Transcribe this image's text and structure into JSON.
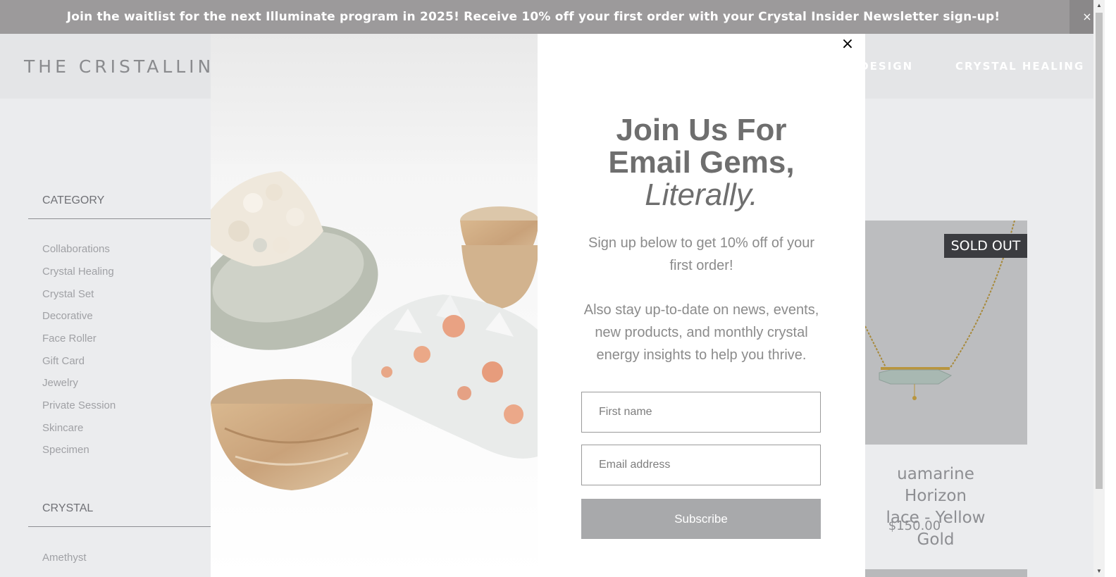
{
  "announcement": {
    "text": "Join the waitlist for the next Illuminate program in 2025! Receive 10% off your first order with your Crystal Insider Newsletter sign-up!",
    "close_label": "×"
  },
  "header": {
    "logo": "THE CRISTALLINE",
    "nav": [
      "C DESIGN",
      "CRYSTAL HEALING"
    ]
  },
  "sidebar": {
    "category_heading": "CATEGORY",
    "categories": [
      "Collaborations",
      "Crystal Healing",
      "Crystal Set",
      "Decorative",
      "Face Roller",
      "Gift Card",
      "Jewelry",
      "Private Session",
      "Skincare",
      "Specimen"
    ],
    "crystal_heading": "CRYSTAL",
    "crystals": [
      "Amethyst"
    ]
  },
  "product": {
    "badge": "SOLD OUT",
    "name_line1": "uamarine Horizon",
    "name_line2": "lace - Yellow Gold",
    "price": "$150.00"
  },
  "modal": {
    "close_label": "×",
    "headline_line1": "Join Us For",
    "headline_line2": "Email Gems,",
    "headline_em": "Literally.",
    "paragraph1": "Sign up below to get 10% off of your first order!",
    "paragraph2": "Also stay up-to-date on news, events, new products, and monthly crystal energy insights to help you thrive.",
    "first_name_placeholder": "First name",
    "email_placeholder": "Email address",
    "subscribe_label": "Subscribe"
  },
  "colors": {
    "announcement_bg": "#9c9a9b",
    "header_bg": "#e4e5e7",
    "badge_bg": "#3b3c40",
    "subscribe_bg": "#a8a9ab"
  }
}
